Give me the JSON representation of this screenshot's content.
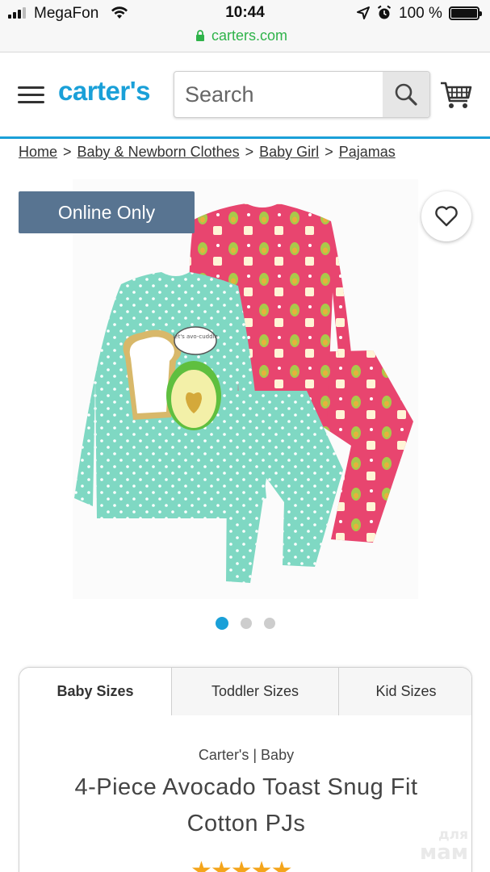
{
  "status_bar": {
    "carrier": "MegaFon",
    "time": "10:44",
    "battery_percent": "100 %"
  },
  "browser": {
    "url": "carters.com"
  },
  "header": {
    "logo_text": "carter's",
    "search_placeholder": "Search"
  },
  "breadcrumb": {
    "items": [
      "Home",
      "Baby & Newborn Clothes",
      "Baby Girl",
      "Pajamas"
    ],
    "separator": ">"
  },
  "product": {
    "badge": "Online Only",
    "image_count": 3,
    "active_image_index": 0,
    "brand_line": "Carter's | Baby",
    "title": "4-Piece Avocado Toast Snug Fit Cotton PJs",
    "rating": 5,
    "stars_text": "★★★★★",
    "image_texts": {
      "speech_bubble": "let's avo-cuddle"
    }
  },
  "size_tabs": [
    {
      "label": "Baby Sizes",
      "active": true
    },
    {
      "label": "Toddler Sizes",
      "active": false
    },
    {
      "label": "Kid Sizes",
      "active": false
    }
  ],
  "watermark": {
    "line1": "для",
    "line2": "мам"
  },
  "colors": {
    "brand_blue": "#1aa0d8",
    "badge_bg": "#587491",
    "url_green": "#2fb34a",
    "star_orange": "#f4a51c",
    "mint": "#7fd8c3",
    "pink": "#e8456f"
  }
}
